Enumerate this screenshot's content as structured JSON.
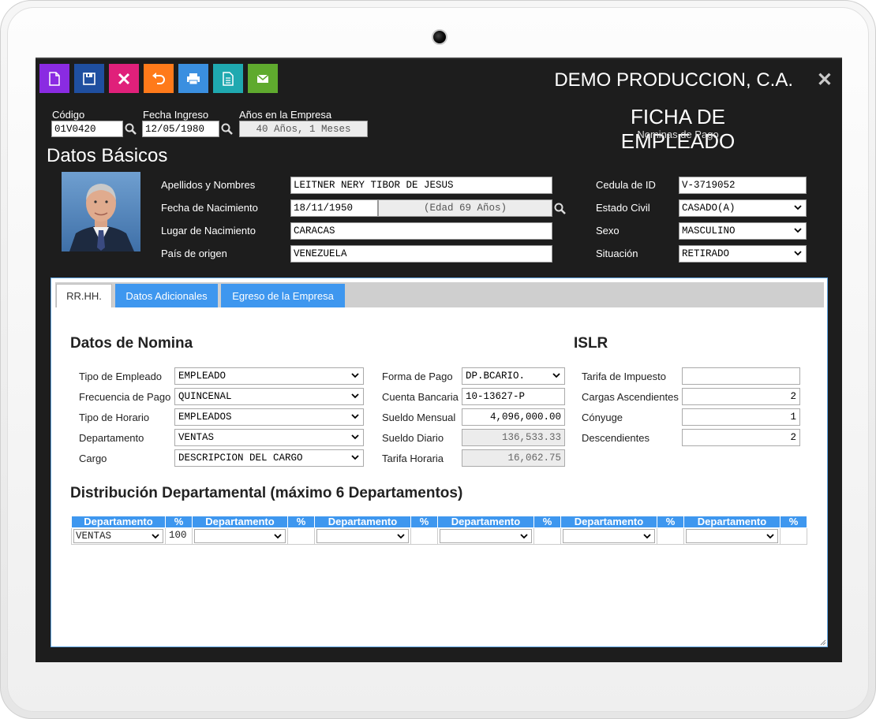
{
  "toolbar": {
    "buttons": [
      {
        "name": "new",
        "icon": "new-document-icon",
        "color": "#8a2be2"
      },
      {
        "name": "save",
        "icon": "save-disk-icon",
        "color": "#1f4fa0"
      },
      {
        "name": "delete",
        "icon": "close-x-icon",
        "color": "#e0207a"
      },
      {
        "name": "undo",
        "icon": "undo-icon",
        "color": "#ff7a1a"
      },
      {
        "name": "print",
        "icon": "printer-icon",
        "color": "#3a8fe0"
      },
      {
        "name": "report",
        "icon": "document-icon",
        "color": "#1fa9b0"
      },
      {
        "name": "email",
        "icon": "envelope-icon",
        "color": "#5faa2e"
      }
    ]
  },
  "header": {
    "company": "DEMO PRODUCCION, C.A.",
    "close": "✕"
  },
  "top_fields": {
    "codigo_label": "Código",
    "codigo_value": "01V0420",
    "fecha_ingreso_label": "Fecha Ingreso",
    "fecha_ingreso_value": "12/05/1980",
    "anos_label": "Años en la Empresa",
    "anos_value": "40 Años, 1 Meses"
  },
  "form_title": {
    "title": "FICHA DE EMPLEADO",
    "subtitle": "Nominas de Pago"
  },
  "datos_basicos": {
    "title": "Datos Básicos",
    "apellidos_label": "Apellidos y Nombres",
    "apellidos_value": "LEITNER NERY TIBOR DE JESUS",
    "nacimiento_label": "Fecha de Nacimiento",
    "nacimiento_value": "18/11/1950",
    "edad_value": "(Edad 69 Años)",
    "lugar_label": "Lugar de Nacimiento",
    "lugar_value": "CARACAS",
    "pais_label": "País de origen",
    "pais_value": "VENEZUELA",
    "cedula_label": "Cedula de ID",
    "cedula_value": "V-3719052",
    "civil_label": "Estado Civil",
    "civil_value": "CASADO(A)",
    "sexo_label": "Sexo",
    "sexo_value": "MASCULINO",
    "situacion_label": "Situación",
    "situacion_value": "RETIRADO"
  },
  "tabs": [
    {
      "label": "RR.HH."
    },
    {
      "label": "Datos Adicionales"
    },
    {
      "label": "Egreso de la Empresa"
    }
  ],
  "nomina": {
    "title": "Datos de Nomina",
    "tipo_empleado_label": "Tipo de Empleado",
    "tipo_empleado_value": "EMPLEADO",
    "frecuencia_label": "Frecuencia de Pago",
    "frecuencia_value": "QUINCENAL",
    "horario_label": "Tipo de Horario",
    "horario_value": "EMPLEADOS",
    "departamento_label": "Departamento",
    "departamento_value": "VENTAS",
    "cargo_label": "Cargo",
    "cargo_value": "DESCRIPCION DEL CARGO",
    "forma_pago_label": "Forma de Pago",
    "forma_pago_value": "DP.BCARIO.",
    "cuenta_label": "Cuenta Bancaria",
    "cuenta_value": "10-13627-P",
    "sueldo_mensual_label": "Sueldo Mensual",
    "sueldo_mensual_value": "4,096,000.00",
    "sueldo_diario_label": "Sueldo Diario",
    "sueldo_diario_value": "136,533.33",
    "tarifa_horaria_label": "Tarifa Horaria",
    "tarifa_horaria_value": "16,062.75"
  },
  "islr": {
    "title": "ISLR",
    "tarifa_label": "Tarifa de Impuesto",
    "tarifa_value": "",
    "cargas_label": "Cargas Ascendientes",
    "cargas_value": "2",
    "conyuge_label": "Cónyuge",
    "conyuge_value": "1",
    "descendientes_label": "Descendientes",
    "descendientes_value": "2"
  },
  "distribucion": {
    "title": "Distribución Departamental (máximo 6 Departamentos)",
    "dept_header": "Departamento",
    "pct_header": "%",
    "rows": [
      {
        "dept": "VENTAS",
        "pct": "100"
      },
      {
        "dept": "",
        "pct": ""
      },
      {
        "dept": "",
        "pct": ""
      },
      {
        "dept": "",
        "pct": ""
      },
      {
        "dept": "",
        "pct": ""
      },
      {
        "dept": "",
        "pct": ""
      }
    ]
  }
}
